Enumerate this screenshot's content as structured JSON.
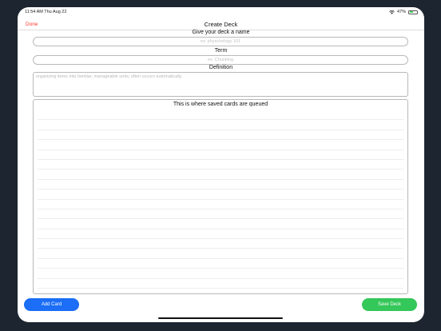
{
  "status_bar": {
    "time": "11:54 AM   Thu Aug 22",
    "battery_text": "47%",
    "battery_level": 0.47,
    "wifi_icon": "wifi-icon",
    "battery_icon": "battery-icon"
  },
  "nav": {
    "done_label": "Done",
    "title": "Create Deck"
  },
  "form": {
    "deck_name_label": "Give your deck a name",
    "deck_name_placeholder": "ex: physchology 101",
    "term_label": "Term",
    "term_placeholder": "ex: Chunking",
    "definition_label": "Definition",
    "definition_placeholder": "organizing items into familiar, manageable units; often occurs automatically"
  },
  "queue": {
    "title": "This is where saved cards are queued"
  },
  "actions": {
    "add_card_label": "Add Card",
    "save_deck_label": "Save Deck"
  },
  "colors": {
    "accent_red": "#ff3b30",
    "add_button_blue": "#1b6ef5",
    "save_button_green": "#34c759",
    "battery_green": "#4cd964"
  }
}
